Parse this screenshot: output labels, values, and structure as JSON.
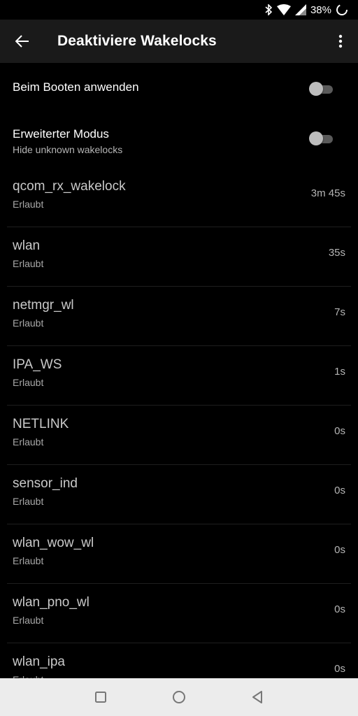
{
  "status_bar": {
    "battery_text": "38%"
  },
  "app_bar": {
    "title": "Deaktiviere Wakelocks"
  },
  "settings": [
    {
      "label": "Beim Booten anwenden",
      "sub": "",
      "enabled": false
    },
    {
      "label": "Erweiterter Modus",
      "sub": "Hide unknown wakelocks",
      "enabled": false
    }
  ],
  "wakelocks": [
    {
      "name": "qcom_rx_wakelock",
      "state": "Erlaubt",
      "time": "3m 45s"
    },
    {
      "name": "wlan",
      "state": "Erlaubt",
      "time": "35s"
    },
    {
      "name": "netmgr_wl",
      "state": "Erlaubt",
      "time": "7s"
    },
    {
      "name": "IPA_WS",
      "state": "Erlaubt",
      "time": "1s"
    },
    {
      "name": "NETLINK",
      "state": "Erlaubt",
      "time": "0s"
    },
    {
      "name": "sensor_ind",
      "state": "Erlaubt",
      "time": "0s"
    },
    {
      "name": "wlan_wow_wl",
      "state": "Erlaubt",
      "time": "0s"
    },
    {
      "name": "wlan_pno_wl",
      "state": "Erlaubt",
      "time": "0s"
    },
    {
      "name": "wlan_ipa",
      "state": "Erlaubt",
      "time": "0s"
    }
  ]
}
